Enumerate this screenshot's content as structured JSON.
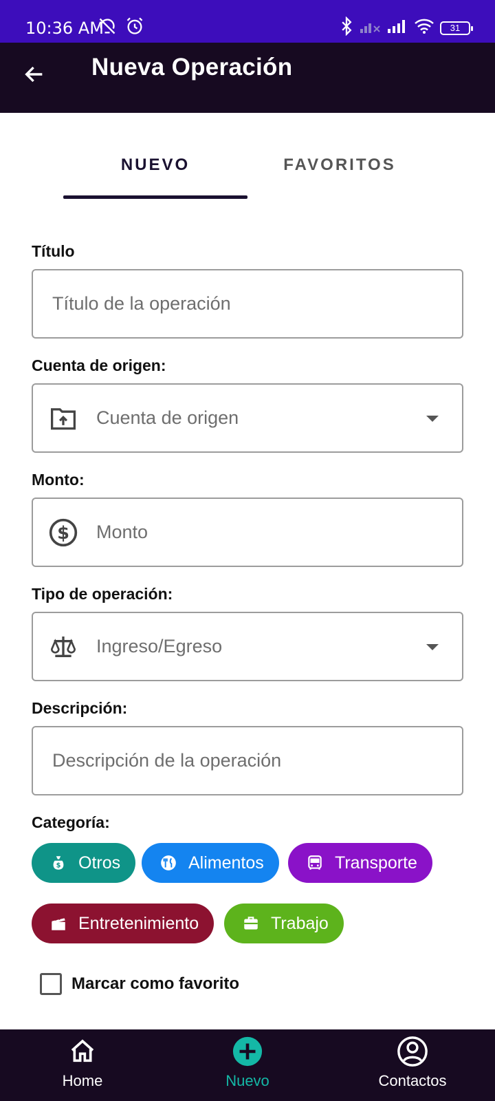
{
  "status_bar": {
    "time": "10:36 AM",
    "battery": "31"
  },
  "app_bar": {
    "title": "Nueva Operación"
  },
  "tabs": [
    {
      "label": "NUEVO",
      "active": true
    },
    {
      "label": "FAVORITOS",
      "active": false
    }
  ],
  "form": {
    "title_label": "Título",
    "title_placeholder": "Título de la operación",
    "account_label": "Cuenta de origen:",
    "account_placeholder": "Cuenta de origen",
    "amount_label": "Monto:",
    "amount_placeholder": "Monto",
    "type_label": "Tipo de operación:",
    "type_placeholder": "Ingreso/Egreso",
    "description_label": "Descripción:",
    "description_placeholder": "Descripción de la operación",
    "category_label": "Categoría:",
    "favorite_label": "Marcar como favorito"
  },
  "categories": [
    {
      "label": "Otros",
      "color": "#0f9488",
      "icon": "money-bag-icon"
    },
    {
      "label": "Alimentos",
      "color": "#1484f0",
      "icon": "food-icon"
    },
    {
      "label": "Transporte",
      "color": "#8a12c8",
      "icon": "bus-icon"
    },
    {
      "label": "Entretenimiento",
      "color": "#8c1230",
      "icon": "clapperboard-icon"
    },
    {
      "label": "Trabajo",
      "color": "#5db31c",
      "icon": "briefcase-icon"
    }
  ],
  "bottom_nav": [
    {
      "label": "Home",
      "icon": "home-icon",
      "active": false
    },
    {
      "label": "Nuevo",
      "icon": "add-circle-icon",
      "active": true
    },
    {
      "label": "Contactos",
      "icon": "account-circle-icon",
      "active": false
    }
  ],
  "colors": {
    "status_bar": "#3d0dbb",
    "app_bar": "#170a21",
    "accent": "#14b8a6"
  }
}
